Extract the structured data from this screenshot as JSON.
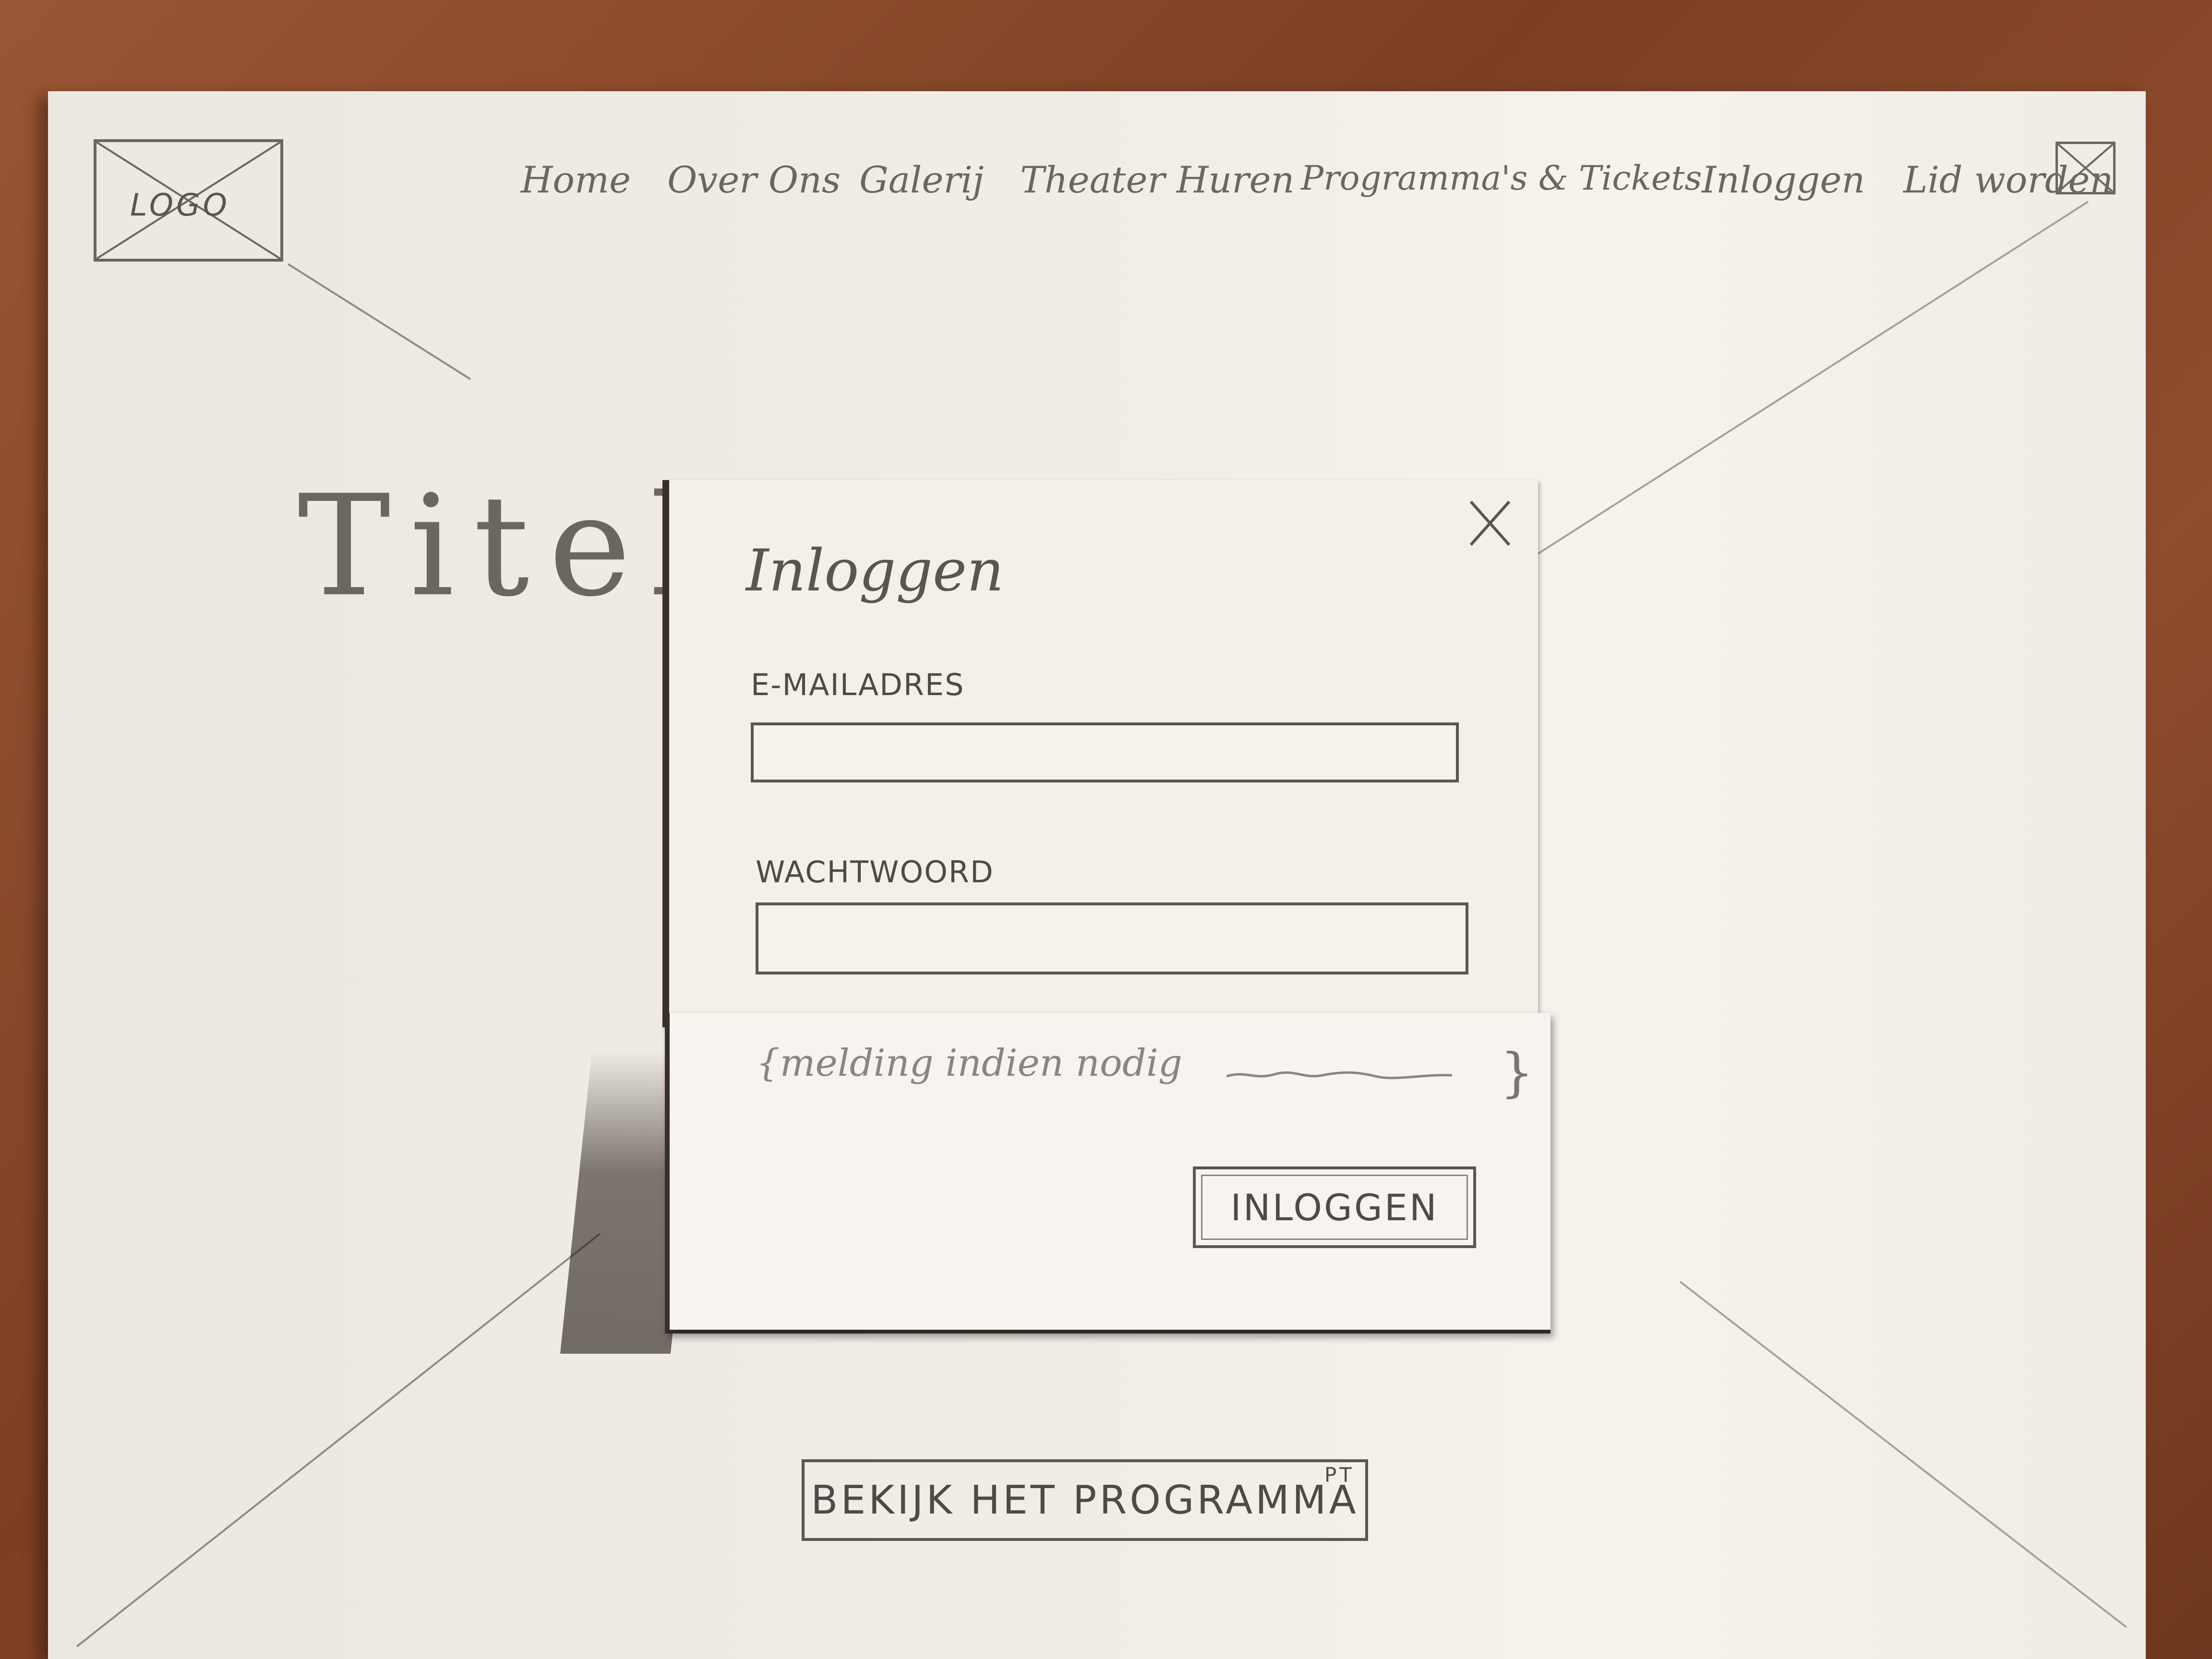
{
  "header": {
    "logo_label": "LOGO",
    "nav": [
      {
        "label": "Home"
      },
      {
        "label": "Over Ons"
      },
      {
        "label": "Galerij"
      },
      {
        "label": "Theater Huren"
      },
      {
        "label": "Programma's & Tickets"
      },
      {
        "label": "Inloggen"
      },
      {
        "label": "Lid worden"
      }
    ],
    "menu_icon": "close-x-icon"
  },
  "hero": {
    "title": "Titel"
  },
  "cta": {
    "label": "BEKIJK HET PROGRAMMA",
    "superscript": "PT"
  },
  "login_modal": {
    "title": "Inloggen",
    "close_icon": "close-icon",
    "email_label": "E-MAILADRES",
    "email_value": "",
    "password_label": "WACHTWOORD",
    "password_value": "",
    "notice": "{melding indien nodig",
    "notice_close": "}",
    "submit_label": "INLOGGEN"
  },
  "colors": {
    "paper": "#f1ede7",
    "pencil": "#6b6660",
    "table": "#8a4a2c"
  }
}
